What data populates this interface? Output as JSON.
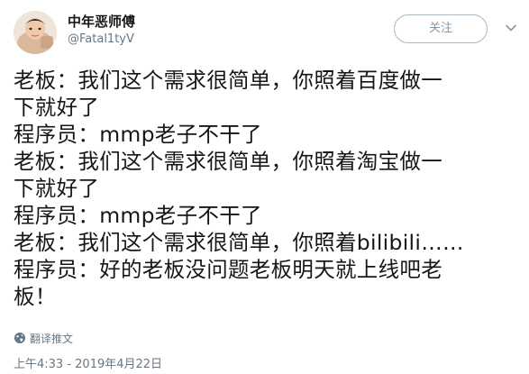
{
  "user": {
    "display_name": "中年恶师傅",
    "handle": "@Fatal1tyV",
    "avatar_icon": "avatar-photo"
  },
  "follow_button": {
    "label": "关注"
  },
  "menu": {
    "icon": "chevron-down-icon"
  },
  "tweet": {
    "lines": [
      "老板：我们这个需求很简单，你照着百度做一",
      "下就好了",
      "程序员：mmp老子不干了",
      "老板：我们这个需求很简单，你照着淘宝做一",
      "下就好了",
      "程序员：mmp老子不干了",
      "老板：我们这个需求很简单，你照着bilibili……",
      "程序员：好的老板没问题老板明天就上线吧老",
      "板！"
    ]
  },
  "translate": {
    "label": "翻译推文",
    "icon": "globe-icon"
  },
  "timestamp": "上午4:33 - 2019年4月22日",
  "colors": {
    "text": "#14171a",
    "secondary": "#657786",
    "button_border": "#aab8c2"
  }
}
